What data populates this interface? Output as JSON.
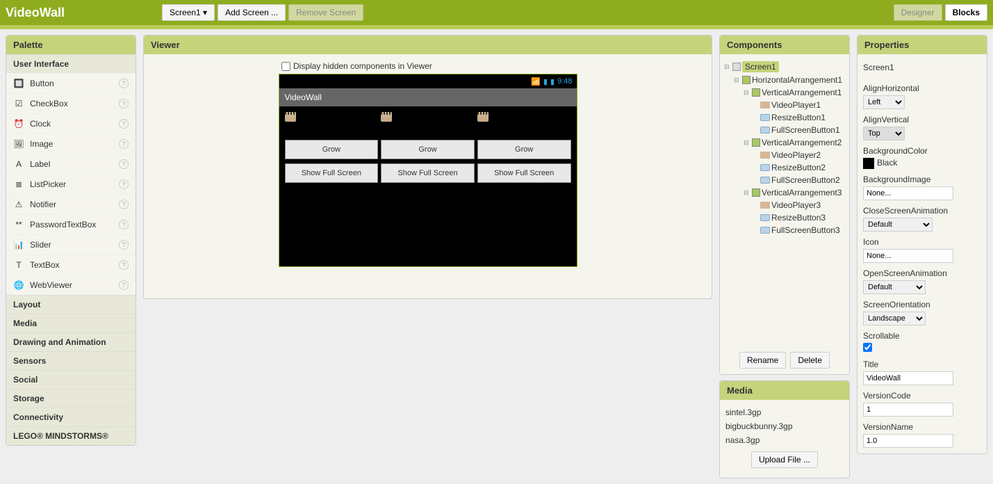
{
  "app": {
    "title": "VideoWall"
  },
  "top": {
    "screen_dropdown": "Screen1 ▾",
    "add_screen": "Add Screen ...",
    "remove_screen": "Remove Screen",
    "designer": "Designer",
    "blocks": "Blocks"
  },
  "palette": {
    "header": "Palette",
    "sections": {
      "ui": "User Interface",
      "layout": "Layout",
      "media": "Media",
      "drawing": "Drawing and Animation",
      "sensors": "Sensors",
      "social": "Social",
      "storage": "Storage",
      "connectivity": "Connectivity",
      "lego": "LEGO® MINDSTORMS®"
    },
    "items": [
      {
        "label": "Button",
        "icon": "🔲"
      },
      {
        "label": "CheckBox",
        "icon": "☑"
      },
      {
        "label": "Clock",
        "icon": "⏰"
      },
      {
        "label": "Image",
        "icon": "🖼"
      },
      {
        "label": "Label",
        "icon": "A"
      },
      {
        "label": "ListPicker",
        "icon": "≣"
      },
      {
        "label": "Notifier",
        "icon": "⚠"
      },
      {
        "label": "PasswordTextBox",
        "icon": "**"
      },
      {
        "label": "Slider",
        "icon": "📊"
      },
      {
        "label": "TextBox",
        "icon": "T"
      },
      {
        "label": "WebViewer",
        "icon": "🌐"
      }
    ]
  },
  "viewer": {
    "header": "Viewer",
    "hidden_label": "Display hidden components in Viewer",
    "phone_time": "9:48",
    "phone_title": "VideoWall",
    "grow": "Grow",
    "fullscreen": "Show Full Screen"
  },
  "components": {
    "header": "Components",
    "tree": {
      "screen": "Screen1",
      "ha1": "HorizontalArrangement1",
      "va1": "VerticalArrangement1",
      "vp1": "VideoPlayer1",
      "rb1": "ResizeButton1",
      "fb1": "FullScreenButton1",
      "va2": "VerticalArrangement2",
      "vp2": "VideoPlayer2",
      "rb2": "ResizeButton2",
      "fb2": "FullScreenButton2",
      "va3": "VerticalArrangement3",
      "vp3": "VideoPlayer3",
      "rb3": "ResizeButton3",
      "fb3": "FullScreenButton3"
    },
    "rename": "Rename",
    "delete": "Delete"
  },
  "media": {
    "header": "Media",
    "files": [
      "sintel.3gp",
      "bigbuckbunny.3gp",
      "nasa.3gp"
    ],
    "upload": "Upload File ..."
  },
  "properties": {
    "header": "Properties",
    "component": "Screen1",
    "labels": {
      "alignH": "AlignHorizontal",
      "alignV": "AlignVertical",
      "bgColor": "BackgroundColor",
      "bgImage": "BackgroundImage",
      "closeAnim": "CloseScreenAnimation",
      "icon": "Icon",
      "openAnim": "OpenScreenAnimation",
      "screenOrient": "ScreenOrientation",
      "scrollable": "Scrollable",
      "title": "Title",
      "versionCode": "VersionCode",
      "versionName": "VersionName"
    },
    "values": {
      "alignH": "Left",
      "alignV": "Top",
      "bgColor": "Black",
      "bgImage": "None...",
      "closeAnim": "Default",
      "icon": "None...",
      "openAnim": "Default",
      "screenOrient": "Landscape",
      "scrollable": true,
      "title": "VideoWall",
      "versionCode": "1",
      "versionName": "1.0"
    }
  }
}
